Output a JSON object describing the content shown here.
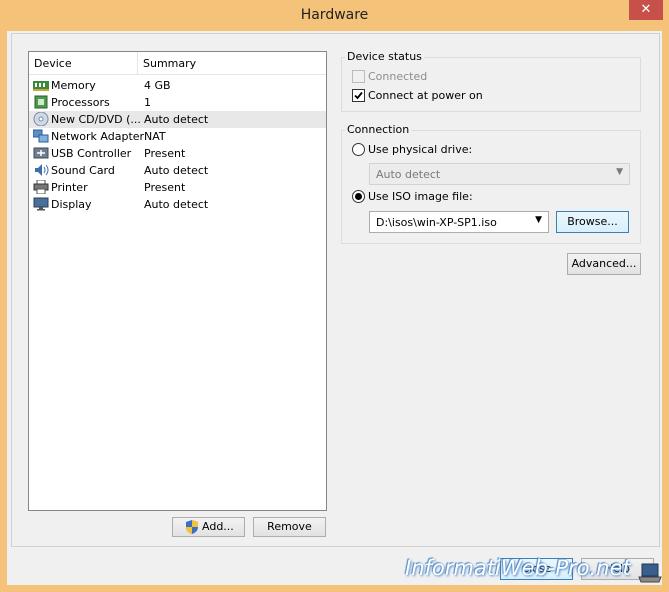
{
  "window": {
    "title": "Hardware",
    "close_glyph": "✕"
  },
  "device_list": {
    "headers": {
      "device": "Device",
      "summary": "Summary"
    },
    "rows": [
      {
        "device": "Memory",
        "summary": "4 GB",
        "icon": "memory-icon"
      },
      {
        "device": "Processors",
        "summary": "1",
        "icon": "processor-icon"
      },
      {
        "device": "New CD/DVD (...",
        "summary": "Auto detect",
        "icon": "cd-dvd-icon",
        "selected": true
      },
      {
        "device": "Network Adapter",
        "summary": "NAT",
        "icon": "network-adapter-icon"
      },
      {
        "device": "USB Controller",
        "summary": "Present",
        "icon": "usb-icon"
      },
      {
        "device": "Sound Card",
        "summary": "Auto detect",
        "icon": "sound-card-icon"
      },
      {
        "device": "Printer",
        "summary": "Present",
        "icon": "printer-icon"
      },
      {
        "device": "Display",
        "summary": "Auto detect",
        "icon": "display-icon"
      }
    ]
  },
  "buttons": {
    "add": "Add...",
    "remove": "Remove",
    "browse": "Browse...",
    "advanced": "Advanced...",
    "close": "Close",
    "help": "Help"
  },
  "device_status": {
    "title": "Device status",
    "connected": {
      "label": "Connected",
      "checked": false,
      "disabled": true
    },
    "connect_at_power_on": {
      "label": "Connect at power on",
      "checked": true
    }
  },
  "connection": {
    "title": "Connection",
    "physical_drive": {
      "label": "Use physical drive:",
      "selected": false,
      "value": "Auto detect"
    },
    "iso_image": {
      "label": "Use ISO image file:",
      "selected": true,
      "value": "D:\\isos\\win-XP-SP1.iso"
    }
  },
  "watermark": "InformatiWeb-Pro.net"
}
